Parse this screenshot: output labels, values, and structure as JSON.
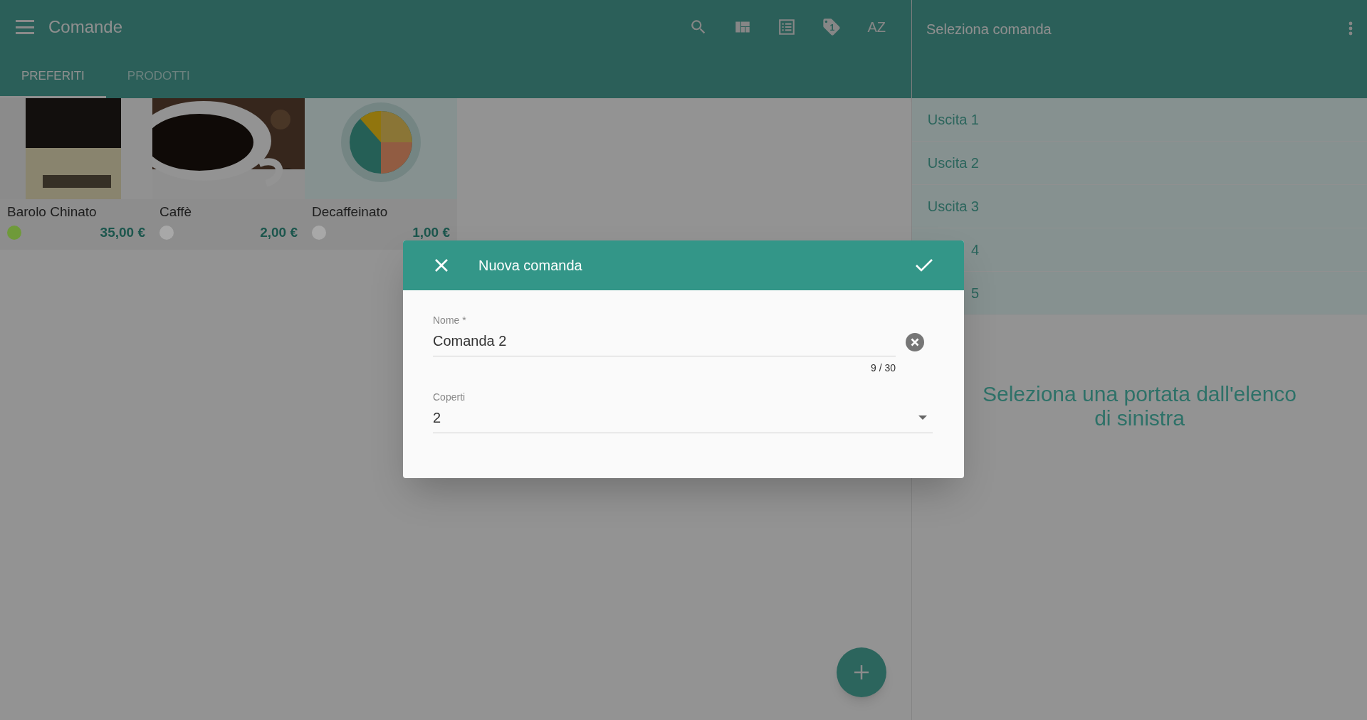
{
  "app_bar": {
    "title": "Comande",
    "tag_count": "1",
    "sort_label": "AZ"
  },
  "tabs": [
    {
      "label": "PREFERITI",
      "selected": true
    },
    {
      "label": "PRODOTTI",
      "selected": false
    }
  ],
  "products": [
    {
      "name": "Barolo Chinato",
      "price": "35,00 €",
      "color": "#6f9a3a"
    },
    {
      "name": "Caffè",
      "price": "2,00 €",
      "color": "#a8a8a8"
    },
    {
      "name": "Decaffeinato",
      "price": "1,00 €",
      "color": "#a8a8a8"
    }
  ],
  "order_panel": {
    "title": "Seleziona comanda",
    "courses": [
      "Uscita 1",
      "Uscita 2",
      "Uscita 3",
      "4",
      "5"
    ],
    "empty_message": "Seleziona una portata dall'elenco di sinistra"
  },
  "dialog": {
    "title": "Nuova comanda",
    "name_field": {
      "label": "Nome *",
      "value": "Comanda 2",
      "counter": "9 / 30"
    },
    "covers_field": {
      "label": "Coperti",
      "value": "2"
    }
  }
}
